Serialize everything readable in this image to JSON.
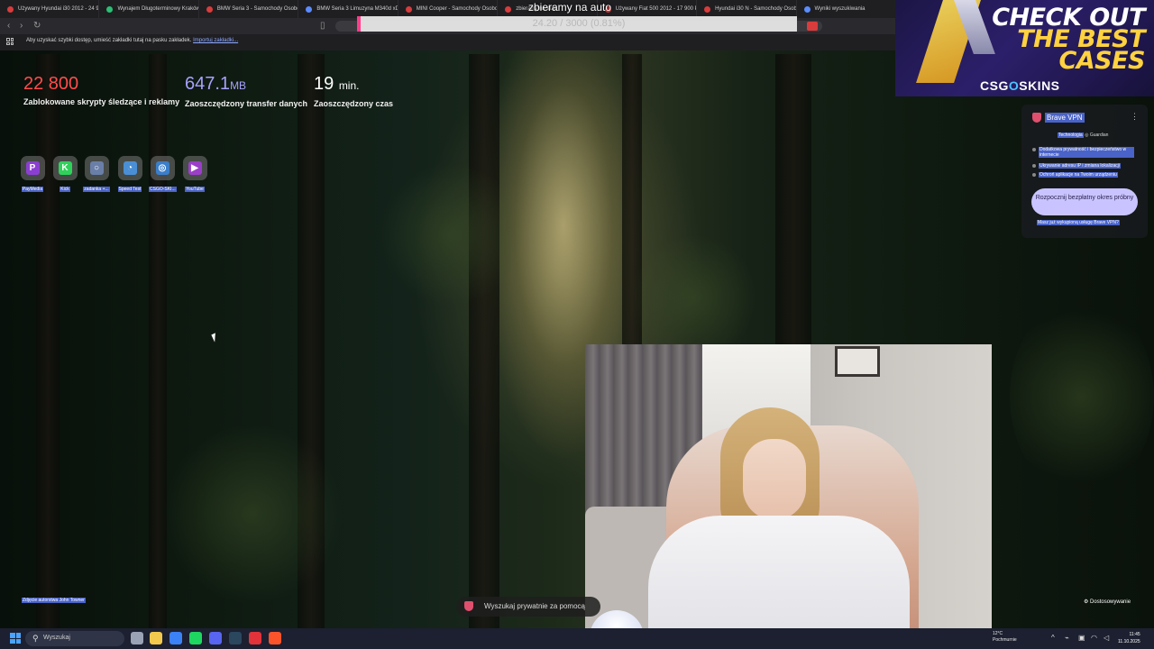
{
  "browser": {
    "tabs": [
      {
        "title": "Używany Hyundai i30 2012 - 24 900",
        "color": "#d93c3c"
      },
      {
        "title": "Wynajem Długoterminowy Kraków",
        "color": "#2bbf74"
      },
      {
        "title": "BMW Seria 3 - Samochody Osobowe",
        "color": "#d93c3c"
      },
      {
        "title": "BMW Seria 3 Limuzyna M340d xDrive",
        "color": "#5b8cff"
      },
      {
        "title": "MINI Cooper - Samochody Osobowe",
        "color": "#d93c3c"
      },
      {
        "title": "zbieramy na auto",
        "color": "#d93c3c"
      },
      {
        "title": "Używany Fiat 500 2012 - 17 900 PLN",
        "color": "#d93c3c"
      },
      {
        "title": "Hyundai i30 N - Samochody Osobowe",
        "color": "#d93c3c"
      },
      {
        "title": "Wyniki wyszukiwania",
        "color": "#5b8cff"
      }
    ],
    "bookmarks_bar": {
      "text": "Aby uzyskać szybki dostęp, umieść zakładki tutaj na pasku zakładek.",
      "link": "Importuj zakładki..."
    }
  },
  "overlay": {
    "goal_title": "zbieramy na auto",
    "goal_progress_text": "24.20 / 3000 (0.81%)",
    "goal_progress": 0.81
  },
  "stats": [
    {
      "value": "22 800",
      "unit": "",
      "label": "Zablokowane skrypty śledzące i reklamy",
      "color": "#ff4d4d"
    },
    {
      "value": "647.1",
      "unit": "MB",
      "label": "Zaoszczędzony transfer danych",
      "color": "#a9a1ff"
    },
    {
      "value": "19",
      "unit": "min.",
      "label": "Zaoszczędzony czas",
      "color": "#ffffff"
    }
  ],
  "shortcuts": [
    {
      "label": "PayMedia",
      "icon": "P",
      "color": "#8b3fd1"
    },
    {
      "label": "Kick",
      "icon": "K",
      "color": "#2fd15a"
    },
    {
      "label": "zadanka +...",
      "icon": "○",
      "color": "#6a7fa8"
    },
    {
      "label": "Speed Test",
      "icon": "◔",
      "color": "#4a8fd6"
    },
    {
      "label": "CSGO-SKI...",
      "icon": "◎",
      "color": "#3b7ec9"
    },
    {
      "label": "YouTube",
      "icon": "▶",
      "color": "#9b3fc9"
    }
  ],
  "ad": {
    "line1": "CHECK OUT",
    "line2": "THE BEST",
    "line3": "CASES",
    "brand_a": "CSG",
    "brand_b": "O",
    "brand_c": "SKINS"
  },
  "vpn": {
    "title": "Brave VPN",
    "tech_prefix": "Technologia",
    "tech_provider": "Guardian",
    "features": [
      "Dodatkowa prywatność i bezpieczeństwo w internecie",
      "Ukrywanie adresu IP i zmiana lokalizacji",
      "Ochroń aplikacje na Twoim urządzeniu"
    ],
    "cta": "Rozpocznij bezpłatny okres próbny",
    "already_bought": "Masz już wykupioną usługę Brave VPN?"
  },
  "footer": {
    "photo_credit": "Zdjęcie autorstwa John Towner",
    "search_placeholder": "Wyszukaj prywatnie za pomocą",
    "customize": "Dostosowywanie"
  },
  "taskbar": {
    "search_label": "Wyszukaj",
    "apps": [
      {
        "name": "task-view",
        "color": "#9aa3b5"
      },
      {
        "name": "file-explorer",
        "color": "#f2c94c"
      },
      {
        "name": "store",
        "color": "#3b82f6"
      },
      {
        "name": "spotify",
        "color": "#1ed760"
      },
      {
        "name": "discord",
        "color": "#5865f2"
      },
      {
        "name": "steam",
        "color": "#2a475e"
      },
      {
        "name": "opera",
        "color": "#e2323a"
      },
      {
        "name": "brave",
        "color": "#fb542b"
      }
    ],
    "weather_temp": "12°C",
    "weather_desc": "Pochmurnie",
    "time": "11:45",
    "date": "11.10.2025"
  }
}
